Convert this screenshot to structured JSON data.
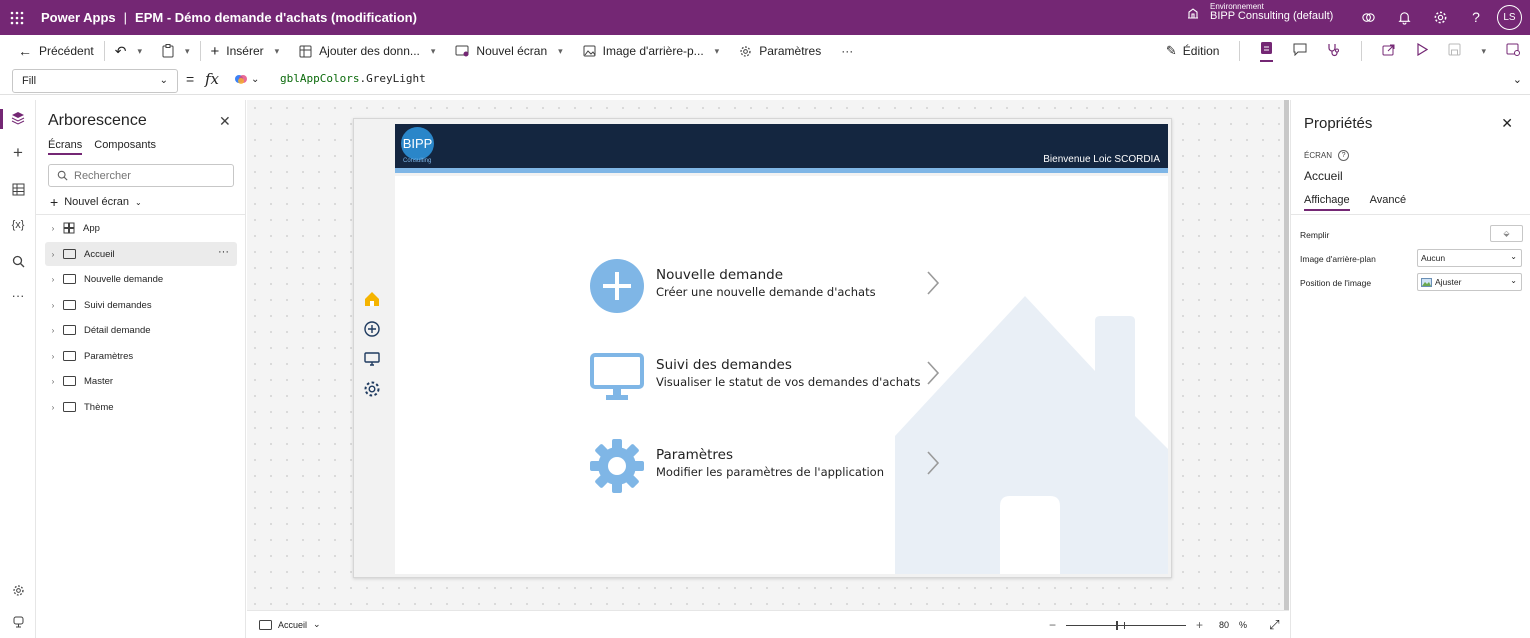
{
  "topbar": {
    "app_name": "Power Apps",
    "separator": "|",
    "doc_title": "EPM - Démo demande d'achats (modification)",
    "env_label": "Environnement",
    "env_name": "BIPP Consulting (default)",
    "avatar_initials": "LS",
    "bg_color": "#742774"
  },
  "commandbar": {
    "back": "Précédent",
    "insert": "Insérer",
    "add_data": "Ajouter des donn...",
    "new_screen": "Nouvel écran",
    "bg_image": "Image d'arrière-p...",
    "settings": "Paramètres",
    "more": "···",
    "edit": "Édition"
  },
  "formulabar": {
    "property": "Fill",
    "equals": "=",
    "fx": "fx",
    "formula_var": "gblAppColors",
    "formula_prop": ".GreyLight"
  },
  "tree": {
    "title": "Arborescence",
    "tabs": [
      "Écrans",
      "Composants"
    ],
    "search_placeholder": "Rechercher",
    "new_screen": "Nouvel écran",
    "items": [
      {
        "label": "App"
      },
      {
        "label": "Accueil"
      },
      {
        "label": "Nouvelle demande"
      },
      {
        "label": "Suivi demandes"
      },
      {
        "label": "Détail demande"
      },
      {
        "label": "Paramètres"
      },
      {
        "label": "Master"
      },
      {
        "label": "Thème"
      }
    ],
    "selected": "Accueil"
  },
  "app_screen": {
    "logo_text": "BIPP",
    "logo_sub": "Consulting",
    "welcome": "Bienvenue Loic SCORDIA",
    "header_color": "#142640",
    "accent_color": "#7fb6e6",
    "menu": [
      {
        "title": "Nouvelle demande",
        "subtitle": "Créer une nouvelle demande d'achats",
        "icon": "plus-circle-icon"
      },
      {
        "title": "Suivi des demandes",
        "subtitle": "Visualiser le statut de vos demandes d'achats",
        "icon": "monitor-icon"
      },
      {
        "title": "Paramètres",
        "subtitle": "Modifier les paramètres de l'application",
        "icon": "gear-icon"
      }
    ]
  },
  "statusbar": {
    "screen": "Accueil",
    "zoom_value": "80",
    "zoom_unit": "%",
    "minus": "−",
    "plus": "+"
  },
  "properties": {
    "title": "Propriétés",
    "kind": "ÉCRAN",
    "screen_name": "Accueil",
    "tabs": [
      "Affichage",
      "Avancé"
    ],
    "rows": [
      {
        "label": "Remplir"
      },
      {
        "label": "Image d'arrière-plan",
        "value": "Aucun"
      },
      {
        "label": "Position de l'image",
        "value": "Ajuster"
      }
    ]
  }
}
